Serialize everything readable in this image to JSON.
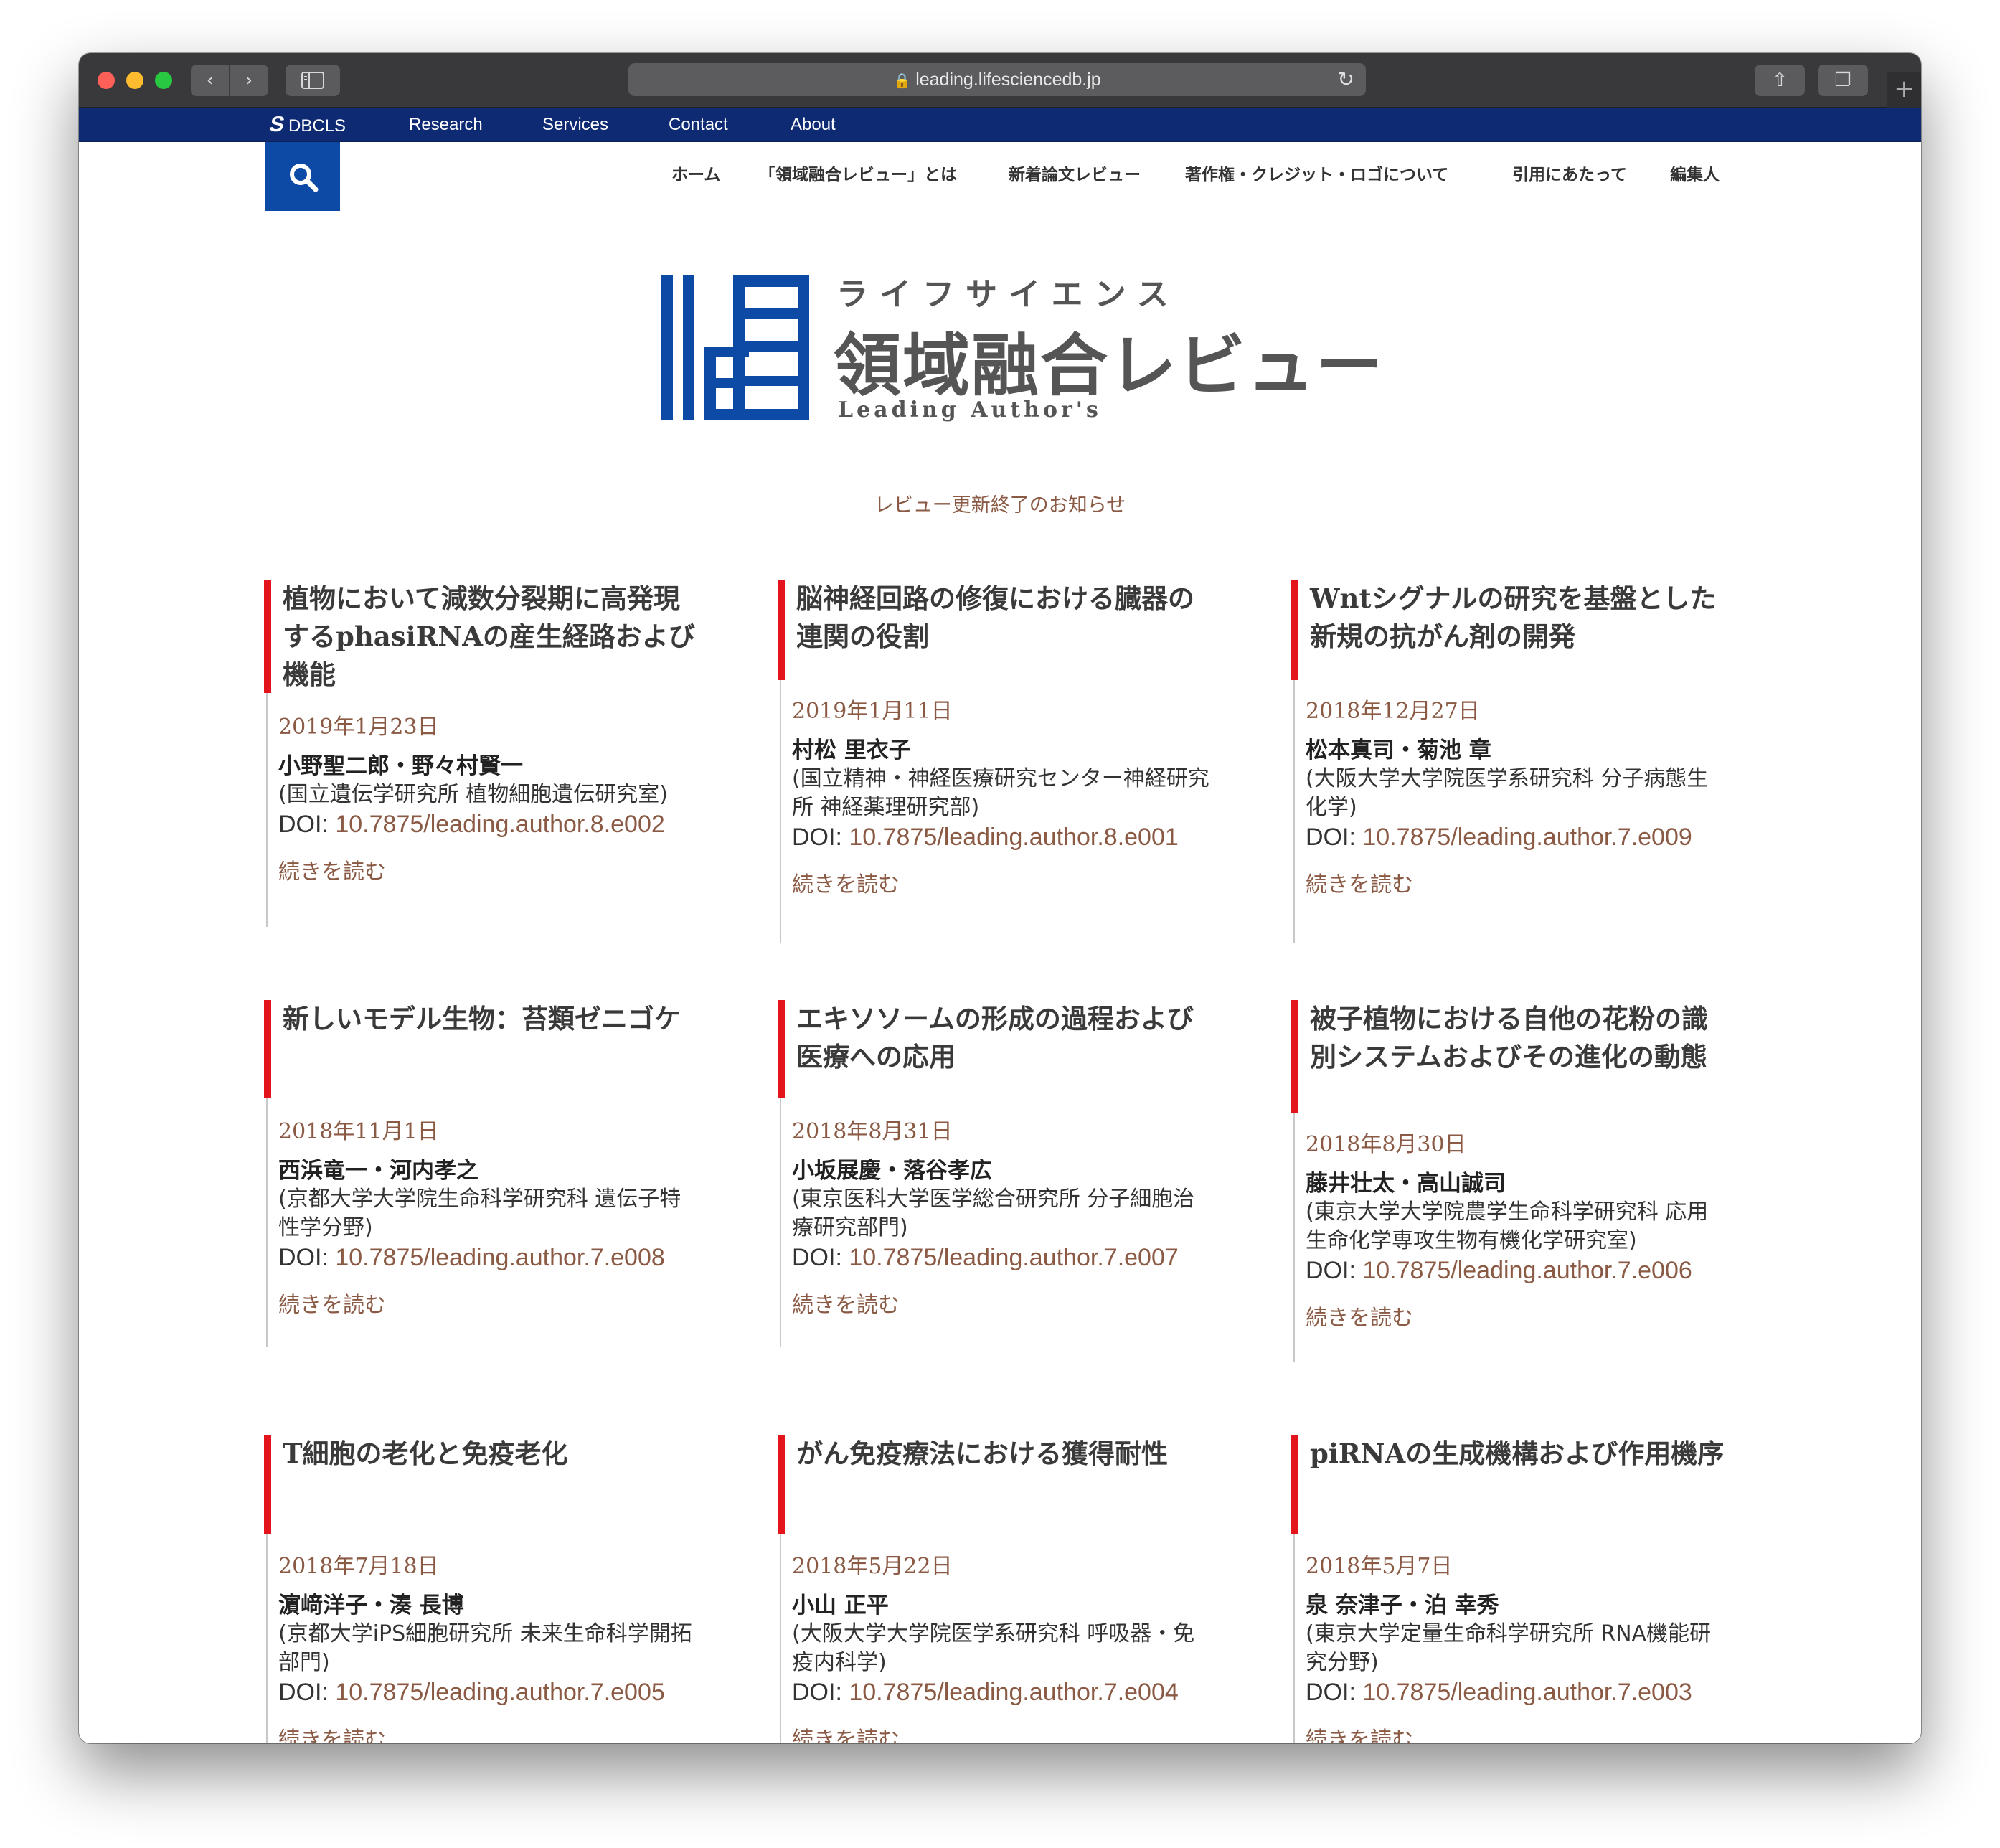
{
  "browser": {
    "url": "leading.lifesciencedb.jp",
    "back_glyph": "‹",
    "forward_glyph": "›",
    "reload_glyph": "↻",
    "share_glyph": "⇧",
    "tabs_glyph": "❐",
    "plus_glyph": "+",
    "icons": [
      "lock-icon",
      "reload-icon",
      "share-icon",
      "tabs-icon",
      "sidebar-icon"
    ]
  },
  "topbar": {
    "logo": "DBCLS",
    "logo_mark": "S",
    "links": [
      "Research",
      "Services",
      "Contact",
      "About"
    ]
  },
  "mainnav": [
    "ホーム",
    "「領域融合レビュー」とは",
    "新着論文レビュー",
    "著作権・クレジット・ロゴについて",
    "引用にあたって",
    "編集人"
  ],
  "site_logo": {
    "sub": "ライフサイエンス",
    "main": "領域融合レビュー",
    "en": "Leading Author's"
  },
  "notice": "レビュー更新終了のお知らせ",
  "colors": {
    "brand_blue": "#0d4aa5",
    "topbar_navy": "#0d2a73",
    "accent_red": "#e3141c",
    "link_brown": "#8a5a44"
  },
  "articles": [
    {
      "title": "植物において減数分裂期に高発現するphasiRNAの産生経路および機能",
      "date": "2019年1月23日",
      "authors": "小野聖二郎・野々村賢一",
      "affiliation": "(国立遺伝学研究所 植物細胞遺伝研究室)",
      "doi_label": "DOI:",
      "doi": "10.7875/leading.author.8.e002",
      "more": "続きを読む"
    },
    {
      "title": "脳神経回路の修復における臓器の連関の役割",
      "date": "2019年1月11日",
      "authors": "村松 里衣子",
      "affiliation": "(国立精神・神経医療研究センター神経研究所 神経薬理研究部)",
      "doi_label": "DOI:",
      "doi": "10.7875/leading.author.8.e001",
      "more": "続きを読む"
    },
    {
      "title": "Wntシグナルの研究を基盤とした新規の抗がん剤の開発",
      "date": "2018年12月27日",
      "authors": "松本真司・菊池 章",
      "affiliation": "(大阪大学大学院医学系研究科 分子病態生化学)",
      "doi_label": "DOI:",
      "doi": "10.7875/leading.author.7.e009",
      "more": "続きを読む"
    },
    {
      "title": "新しいモデル生物：苔類ゼニゴケ",
      "date": "2018年11月1日",
      "authors": "西浜竜一・河内孝之",
      "affiliation": "(京都大学大学院生命科学研究科 遺伝子特性学分野)",
      "doi_label": "DOI:",
      "doi": "10.7875/leading.author.7.e008",
      "more": "続きを読む"
    },
    {
      "title": "エキソソームの形成の過程および医療への応用",
      "date": "2018年8月31日",
      "authors": "小坂展慶・落谷孝広",
      "affiliation": "(東京医科大学医学総合研究所 分子細胞治療研究部門)",
      "doi_label": "DOI:",
      "doi": "10.7875/leading.author.7.e007",
      "more": "続きを読む"
    },
    {
      "title": "被子植物における自他の花粉の識別システムおよびその進化の動態",
      "date": "2018年8月30日",
      "authors": "藤井壮太・高山誠司",
      "affiliation": "(東京大学大学院農学生命科学研究科 応用生命化学専攻生物有機化学研究室)",
      "doi_label": "DOI:",
      "doi": "10.7875/leading.author.7.e006",
      "more": "続きを読む"
    },
    {
      "title": "T細胞の老化と免疫老化",
      "date": "2018年7月18日",
      "authors": "濵﨑洋子・湊 長博",
      "affiliation": "(京都大学iPS細胞研究所 未来生命科学開拓部門)",
      "doi_label": "DOI:",
      "doi": "10.7875/leading.author.7.e005",
      "more": "続きを読む"
    },
    {
      "title": "がん免疫療法における獲得耐性",
      "date": "2018年5月22日",
      "authors": "小山 正平",
      "affiliation": "(大阪大学大学院医学系研究科 呼吸器・免疫内科学)",
      "doi_label": "DOI:",
      "doi": "10.7875/leading.author.7.e004",
      "more": "続きを読む"
    },
    {
      "title": "piRNAの生成機構および作用機序",
      "date": "2018年5月7日",
      "authors": "泉 奈津子・泊 幸秀",
      "affiliation": "(東京大学定量生命科学研究所 RNA機能研究分野)",
      "doi_label": "DOI:",
      "doi": "10.7875/leading.author.7.e003",
      "more": "続きを読む"
    }
  ]
}
